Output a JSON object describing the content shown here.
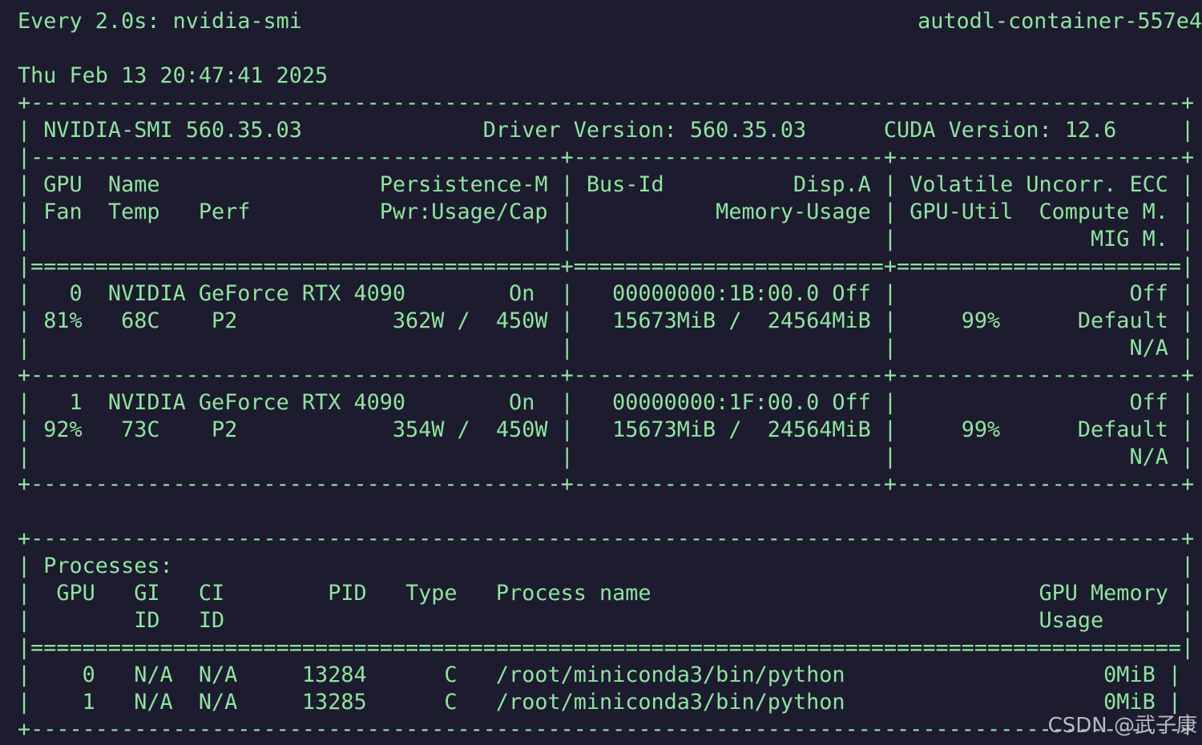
{
  "header": {
    "command": "Every 2.0s: nvidia-smi",
    "hostname": "autodl-container-557e4",
    "timestamp": "Thu Feb 13 20:47:41 2025"
  },
  "smi_lines": [
    "+-----------------------------------------------------------------------------------------+",
    "| NVIDIA-SMI 560.35.03              Driver Version: 560.35.03      CUDA Version: 12.6     |",
    "|-----------------------------------------+------------------------+----------------------+",
    "| GPU  Name                 Persistence-M | Bus-Id          Disp.A | Volatile Uncorr. ECC |",
    "| Fan  Temp   Perf          Pwr:Usage/Cap |           Memory-Usage | GPU-Util  Compute M. |",
    "|                                         |                        |               MIG M. |",
    "|=========================================+========================+======================|",
    "|   0  NVIDIA GeForce RTX 4090        On  |   00000000:1B:00.0 Off |                  Off |",
    "| 81%   68C    P2            362W /  450W |   15673MiB /  24564MiB |     99%      Default |",
    "|                                         |                        |                  N/A |",
    "+-----------------------------------------+------------------------+----------------------+",
    "|   1  NVIDIA GeForce RTX 4090        On  |   00000000:1F:00.0 Off |                  Off |",
    "| 92%   73C    P2            354W /  450W |   15673MiB /  24564MiB |     99%      Default |",
    "|                                         |                        |                  N/A |",
    "+-----------------------------------------+------------------------+----------------------+",
    "",
    "+-----------------------------------------------------------------------------------------+",
    "| Processes:                                                                              |",
    "|  GPU   GI   CI        PID   Type   Process name                              GPU Memory |",
    "|        ID   ID                                                               Usage      |",
    "|=========================================================================================|",
    "|    0   N/A  N/A     13284      C   /root/miniconda3/bin/python                    0MiB |",
    "|    1   N/A  N/A     13285      C   /root/miniconda3/bin/python                    0MiB |",
    "+-----------------------------------------------------------------------------------------+"
  ],
  "watermark": "CSDN @武子康",
  "colors": {
    "background": "#1c1c2e",
    "text": "#8fe3a0"
  }
}
